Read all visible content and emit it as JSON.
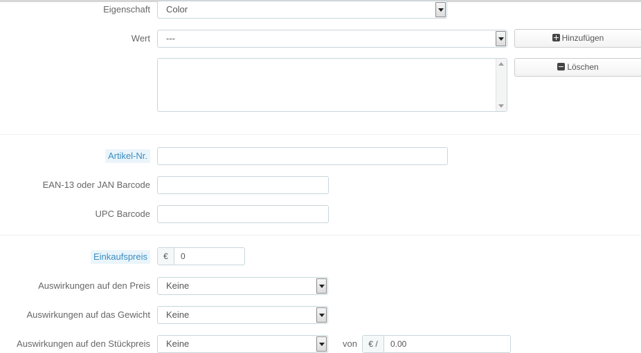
{
  "attribute": {
    "label": "Eigenschaft",
    "value": "Color"
  },
  "value_field": {
    "label": "Wert",
    "value": "---"
  },
  "buttons": {
    "add": "Hinzufügen",
    "delete": "Löschen"
  },
  "reference": {
    "label": "Artikel-Nr.",
    "value": ""
  },
  "ean13": {
    "label": "EAN-13 oder JAN Barcode",
    "value": ""
  },
  "upc": {
    "label": "UPC Barcode",
    "value": ""
  },
  "wholesale_price": {
    "label": "Einkaufspreis",
    "currency": "€",
    "value": "0"
  },
  "impact_price": {
    "label": "Auswirkungen auf den Preis",
    "value": "Keine"
  },
  "impact_weight": {
    "label": "Auswirkungen auf das Gewicht",
    "value": "Keine"
  },
  "impact_unit_price": {
    "label": "Auswirkungen auf den Stückpreis",
    "value": "Keine",
    "of_label": "von",
    "unit_currency": "€ /",
    "unit_value": "0.00"
  }
}
